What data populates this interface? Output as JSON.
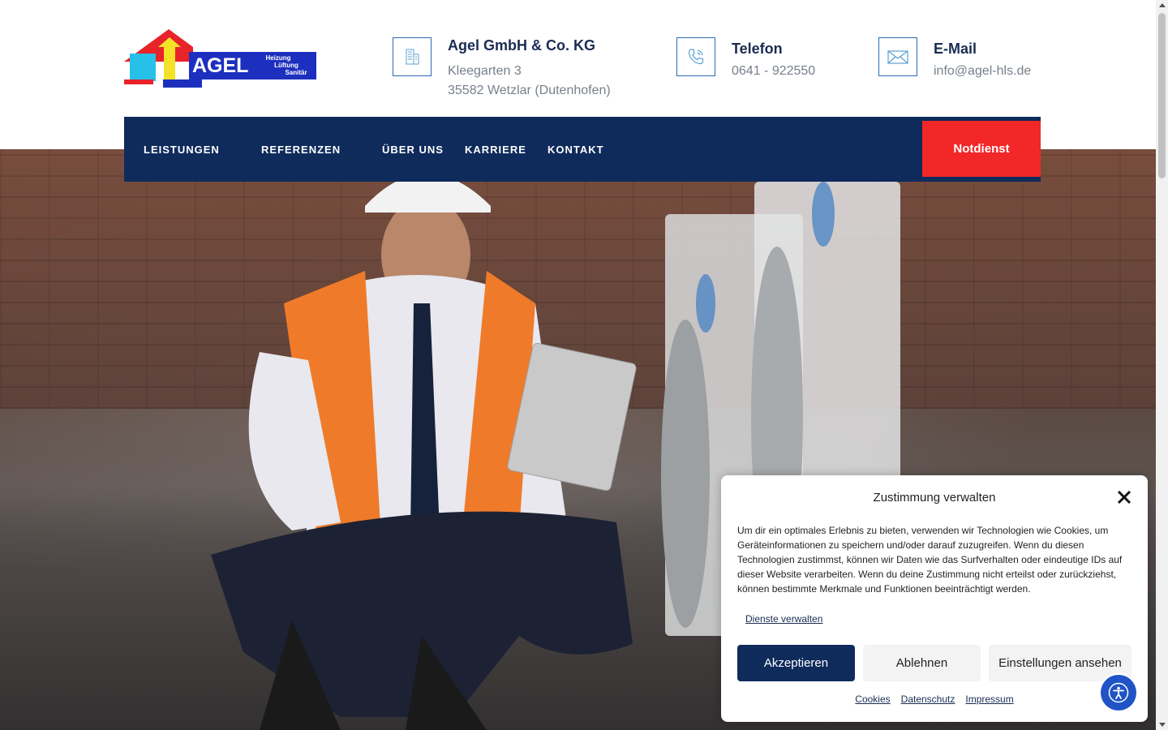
{
  "header": {
    "logo": {
      "text": "AGEL",
      "tag1": "Heizung",
      "tag2": "Lüftung",
      "tag3": "Sanitär"
    },
    "company": {
      "title": "Agel GmbH & Co. KG",
      "street": "Kleegarten 3",
      "city": "35582 Wetzlar (Dutenhofen)"
    },
    "phone": {
      "title": "Telefon",
      "value": "0641 - 922550"
    },
    "email": {
      "title": "E-Mail",
      "value": "info@agel-hls.de"
    }
  },
  "nav": {
    "items": [
      {
        "label": "LEISTUNGEN"
      },
      {
        "label": "REFERENZEN"
      },
      {
        "label": "ÜBER UNS"
      },
      {
        "label": "KARRIERE"
      },
      {
        "label": "KONTAKT"
      }
    ],
    "cta": "Notdienst"
  },
  "cookie": {
    "title": "Zustimmung verwalten",
    "text": "Um dir ein optimales Erlebnis zu bieten, verwenden wir Technologien wie Cookies, um Geräteinformationen zu speichern und/oder darauf zuzugreifen. Wenn du diesen Technologien zustimmst, können wir Daten wie das Surfverhalten oder eindeutige IDs auf dieser Website verarbeiten. Wenn du deine Zustimmung nicht erteilst oder zurückziehst, können bestimmte Merkmale und Funktionen beeinträchtigt werden.",
    "manage": "Dienste verwalten",
    "accept": "Akzeptieren",
    "deny": "Ablehnen",
    "settings": "Einstellungen ansehen",
    "links": {
      "cookies": "Cookies",
      "privacy": "Datenschutz",
      "imprint": "Impressum"
    }
  },
  "colors": {
    "navy": "#0f2b5c",
    "red": "#f22727",
    "accent_blue": "#2a6bb0"
  }
}
